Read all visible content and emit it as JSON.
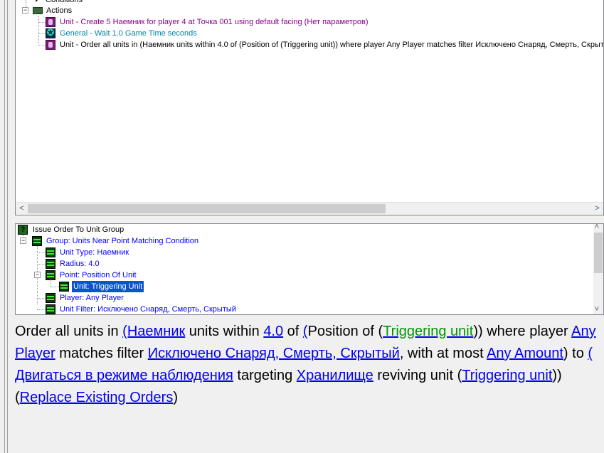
{
  "top_tree": {
    "conditions_label": "Conditions",
    "actions_label": "Actions",
    "actions": [
      {
        "text": "Unit - Create 5 Наемник for player 4 at Точка 001 using default facing (Нет параметров)",
        "icon": "unit-icon",
        "color": "#8b008b"
      },
      {
        "text": "General - Wait 1.0 Game Time seconds",
        "icon": "general-icon",
        "color": "#0084a8"
      },
      {
        "text": "Unit - Order all units in (Наемник units within 4.0 of (Position of (Triggering unit)) where player Any Player matches filter Исключено Снаряд, Смерть, Скрытый, w",
        "icon": "unit-icon",
        "color": "#000000"
      }
    ]
  },
  "param_tree": {
    "root": "Issue Order To Unit Group",
    "group": "Group: Units Near Point Matching Condition",
    "unit_type": "Unit Type: Наемник",
    "radius": "Radius: 4.0",
    "point": "Point: Position Of Unit",
    "unit": "Unit: Triggering Unit",
    "player": "Player: Any Player",
    "unit_filter": "Unit Filter: Исключено Снаряд, Смерть, Скрытый"
  },
  "description": {
    "t1": "Order all units in ",
    "l1": "(Наемник",
    "t2": " units within ",
    "l2": "4.0",
    "t3": " of ",
    "l3": "(",
    "t4": "Position of (",
    "l4": "Triggering unit",
    "t5": ")) where player ",
    "l5": "Any Player",
    "t6": " matches filter ",
    "l6": "Исключено Снаряд, Смерть, Скрытый",
    "t7": ", with at most ",
    "l7": "Any Amount",
    "t8": ") to ",
    "l8": "( Двигаться в режиме наблюдения",
    "t9": " targeting ",
    "l9": "Хранилище",
    "t10": " reviving unit (",
    "l10": "Triggering unit",
    "t11": ")) (",
    "l11": "Replace Existing Orders",
    "t12": ")"
  },
  "colors": {
    "selection": "#0a56c8",
    "link": "#0000ee",
    "preset_link": "#009600"
  }
}
